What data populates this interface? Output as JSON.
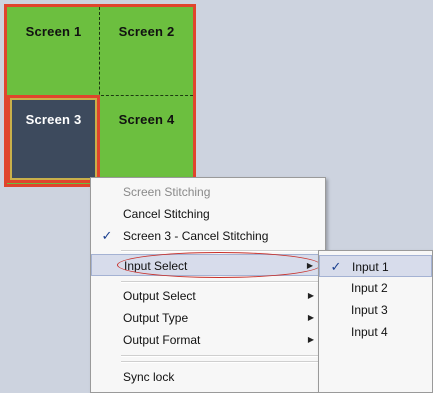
{
  "screens": [
    {
      "label": "Screen 1",
      "selected": false
    },
    {
      "label": "Screen 2",
      "selected": false
    },
    {
      "label": "Screen 3",
      "selected": true
    },
    {
      "label": "Screen 4",
      "selected": false
    }
  ],
  "colors": {
    "grid_green": "#6cbf3f",
    "selected_screen": "#3d4a5d",
    "border_red": "#e0452c",
    "menu_bg": "#f7f7f7",
    "highlight": "#d7dceb"
  },
  "context_menu": {
    "items": [
      {
        "label": "Screen Stitching",
        "disabled": true
      },
      {
        "label": "Cancel Stitching"
      },
      {
        "label": "Screen 3 - Cancel Stitching",
        "checked": true,
        "check_glyph": "✓"
      },
      {
        "label": "Input Select",
        "highlighted": true,
        "submenu_arrow": "▶"
      },
      {
        "label": "Output Select",
        "submenu_arrow": "▶"
      },
      {
        "label": "Output Type",
        "submenu_arrow": "▶"
      },
      {
        "label": "Output Format",
        "submenu_arrow": "▶"
      },
      {
        "label": "Sync lock"
      }
    ]
  },
  "input_submenu": {
    "items": [
      {
        "label": "Input 1",
        "checked": true,
        "check_glyph": "✓"
      },
      {
        "label": "Input 2"
      },
      {
        "label": "Input 3"
      },
      {
        "label": "Input 4"
      }
    ]
  },
  "icons": {
    "check": "check-icon",
    "submenu_arrow": "chevron-right-icon"
  }
}
